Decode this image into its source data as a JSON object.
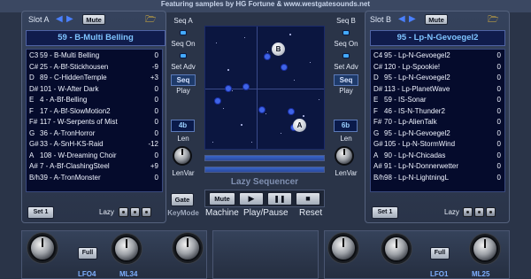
{
  "header": {
    "credit": "Featuring samples by HG Fortune & www.westgatesounds.net"
  },
  "slot_a": {
    "label": "Slot A",
    "mute_label": "Mute",
    "selected_name": "59 - B-Multi Belling",
    "rows": [
      {
        "note": "C3",
        "name": "59 - B-Multi Belling",
        "offset": "0"
      },
      {
        "note": "C#",
        "name": "25 - A-Bf-Stickhousen",
        "offset": "-9"
      },
      {
        "note": "D",
        "name": "89 - C-HiddenTemple",
        "offset": "+3"
      },
      {
        "note": "D#",
        "name": "101 - W-After Dark",
        "offset": "0"
      },
      {
        "note": "E",
        "name": "4 - A-Bf-Belling",
        "offset": "0"
      },
      {
        "note": "F",
        "name": "17 - A-Bf-SlowMotion2",
        "offset": "0"
      },
      {
        "note": "F#",
        "name": "117 - W-Serpents of Mist",
        "offset": "0"
      },
      {
        "note": "G",
        "name": "36 - A-TronHorror",
        "offset": "0"
      },
      {
        "note": "G#",
        "name": "33 - A-SnH-KS-Raid",
        "offset": "-12"
      },
      {
        "note": "A",
        "name": "108 - W-Dreaming Choir",
        "offset": "0"
      },
      {
        "note": "A#",
        "name": "7 - A-Bf-ClashingSteel",
        "offset": "+9"
      },
      {
        "note": "B/h",
        "name": "39 - A-TronMonster",
        "offset": "0"
      }
    ],
    "set_label": "Set 1",
    "lazy_label": "Lazy"
  },
  "slot_b": {
    "label": "Slot B",
    "mute_label": "Mute",
    "selected_name": "95 - Lp-N-Gevoegel2",
    "rows": [
      {
        "note": "C4",
        "name": "95 - Lp-N-Gevoegel2",
        "offset": "0"
      },
      {
        "note": "C#",
        "name": "120 - Lp-Spookie!",
        "offset": "0"
      },
      {
        "note": "D",
        "name": "95 - Lp-N-Gevoegel2",
        "offset": "0"
      },
      {
        "note": "D#",
        "name": "113 - Lp-PlanetWave",
        "offset": "0"
      },
      {
        "note": "E",
        "name": "59 - IS-Sonar",
        "offset": "0"
      },
      {
        "note": "F",
        "name": "46 - IS-N-Thunder2",
        "offset": "0"
      },
      {
        "note": "F#",
        "name": "70 - Lp-AlienTalk",
        "offset": "0"
      },
      {
        "note": "G",
        "name": "95 - Lp-N-Gevoegel2",
        "offset": "0"
      },
      {
        "note": "G#",
        "name": "105 - Lp-N-StormWind",
        "offset": "0"
      },
      {
        "note": "A",
        "name": "90 - Lp-N-Chicadas",
        "offset": "0"
      },
      {
        "note": "A#",
        "name": "91 - Lp-N-Donnerwetter",
        "offset": "0"
      },
      {
        "note": "B/h",
        "name": "98 - Lp-N-LightningL",
        "offset": "0"
      }
    ],
    "set_label": "Set 1",
    "lazy_label": "Lazy"
  },
  "seq_a": {
    "title": "Seq A",
    "on_label": "Seq On",
    "set_adv_label": "Set Adv",
    "seq_label": "Seq",
    "play_label": "Play",
    "len_value": "4b",
    "len_label": "Len",
    "lenvar_label": "LenVar"
  },
  "seq_b": {
    "title": "Seq B",
    "on_label": "Seq On",
    "set_adv_label": "Set Adv",
    "seq_label": "Seq",
    "play_label": "Play",
    "len_value": "6b",
    "len_label": "Len",
    "lenvar_label": "LenVar"
  },
  "center": {
    "marker_a": "A",
    "marker_b": "B",
    "title": "Lazy Sequencer",
    "gate_label": "Gate",
    "keymode_label": "KeyMode",
    "mute_label": "Mute",
    "machine_label": "Machine",
    "playpause_label": "Play/Pause",
    "reset_label": "Reset",
    "play_icon": "▶",
    "pause_icon": "❚❚",
    "stop_icon": "■",
    "slider_top_level": 1.0,
    "slider_bottom_level": 1.0
  },
  "bottom": {
    "full_left": "Full",
    "full_right": "Full",
    "lfo_left": "LFO4",
    "ml_left": "ML34",
    "lfo_right": "LFO1",
    "ml_right": "ML25"
  },
  "colors": {
    "accent": "#4a80ff",
    "list_bg": "#050b2c",
    "name_text": "#7fc4ff"
  }
}
